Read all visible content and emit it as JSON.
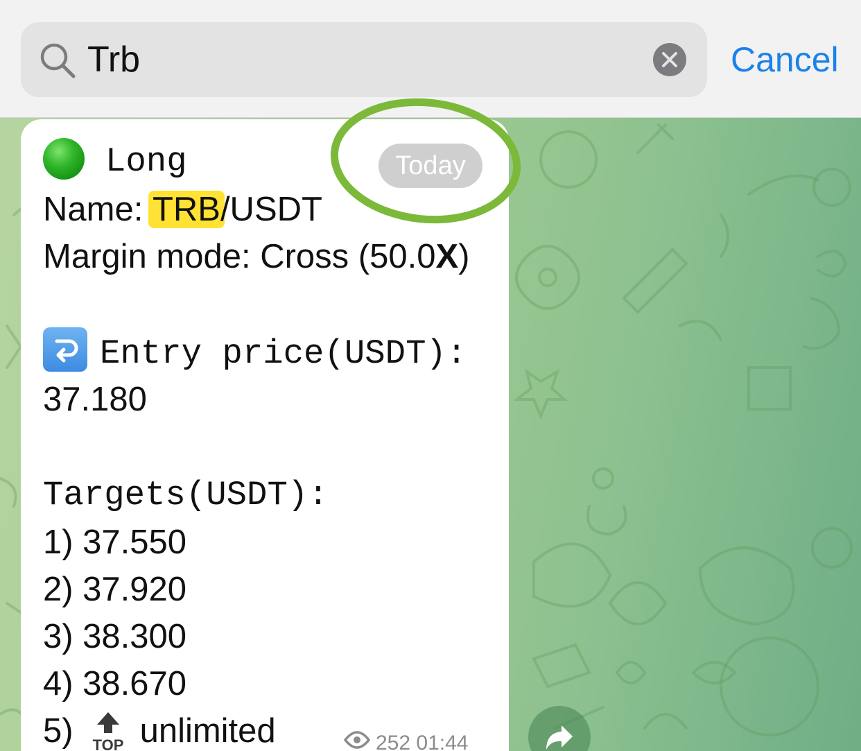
{
  "search": {
    "query": "Trb",
    "cancel_label": "Cancel"
  },
  "message": {
    "direction_label": "Long",
    "name_prefix": "Name: ",
    "name_highlight": "TRB",
    "name_suffix": "/USDT",
    "margin_prefix": "Margin mode: Cross (50.0",
    "margin_bold": "X",
    "margin_suffix": ")",
    "entry_label": "Entry price(USDT):",
    "entry_value": "37.180",
    "targets_label": "Targets(USDT):",
    "targets": [
      "1) 37.550",
      "2) 37.920",
      "3) 38.300",
      "4) 38.670"
    ],
    "target5_prefix": "5)",
    "target5_icon_text": "TOP",
    "target5_value": "unlimited",
    "views": "252",
    "time": "01:44"
  },
  "date_badge": "Today",
  "colors": {
    "accent": "#1a82e8",
    "highlight": "#ffe233",
    "annotation": "#7cb93a",
    "status_dot": "#22a81c"
  },
  "icons": {
    "search": "search-icon",
    "clear": "clear-icon",
    "status": "green-circle-icon",
    "entry": "return-arrow-icon",
    "top": "top-arrow-icon",
    "views": "eye-icon",
    "share": "share-icon"
  }
}
